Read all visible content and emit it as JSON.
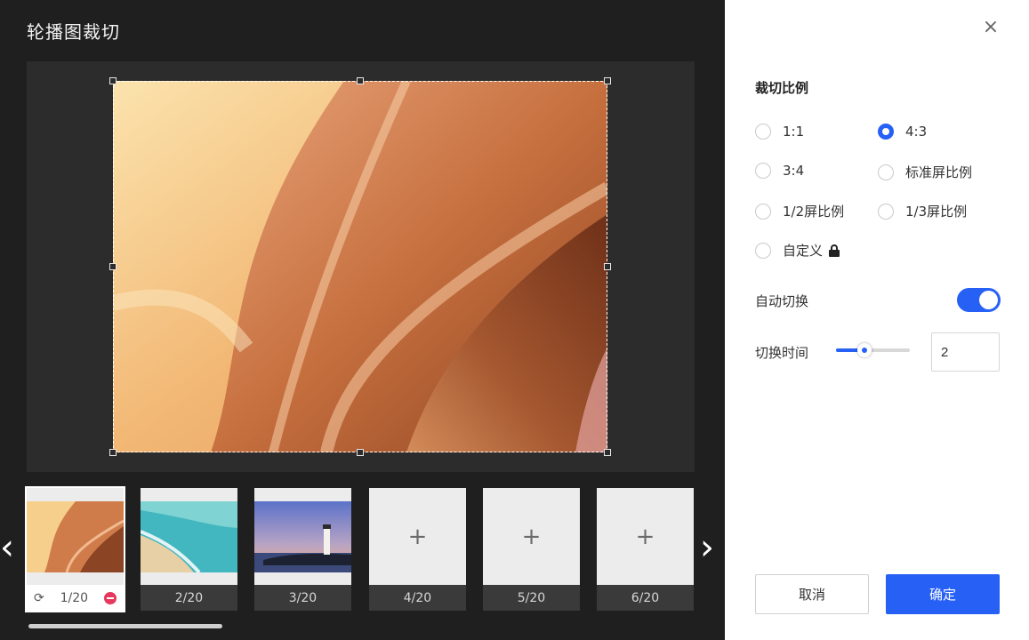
{
  "editor": {
    "title": "轮播图裁切"
  },
  "thumbnails": [
    {
      "label": "1/20",
      "image": "antelope-canyon",
      "active": true
    },
    {
      "label": "2/20",
      "image": "beach-aerial"
    },
    {
      "label": "3/20",
      "image": "lighthouse-sunset"
    },
    {
      "label": "4/20",
      "image": "empty-add"
    },
    {
      "label": "5/20",
      "image": "empty-add"
    },
    {
      "label": "6/20",
      "image": "empty-add"
    }
  ],
  "thumb_add_glyph": "+",
  "panel": {
    "close_glyph": "×",
    "ratio_title": "裁切比例",
    "ratios": [
      {
        "label": "1:1",
        "checked": false
      },
      {
        "label": "4:3",
        "checked": true
      },
      {
        "label": "3:4",
        "checked": false
      },
      {
        "label": "标准屏比例",
        "checked": false
      },
      {
        "label": "1/2屏比例",
        "checked": false
      },
      {
        "label": "1/3屏比例",
        "checked": false
      },
      {
        "label": "自定义",
        "checked": false
      }
    ],
    "auto_switch_label": "自动切换",
    "auto_switch_on": true,
    "switch_time_label": "切换时间",
    "switch_time_value": "2",
    "slider_level": 0.38,
    "cancel_label": "取消",
    "confirm_label": "确定"
  },
  "colors": {
    "accent": "#2660f5",
    "editor_bg": "#1f1f1f",
    "canvas_bg": "#2c2c2c",
    "remove": "#e6385c"
  }
}
